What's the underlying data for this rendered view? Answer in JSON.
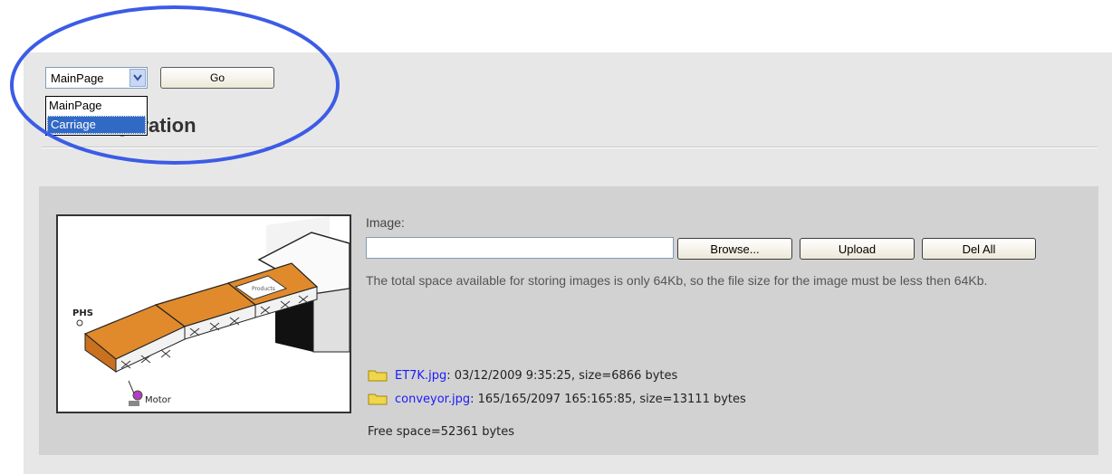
{
  "nav": {
    "select_value": "MainPage",
    "go_label": "Go",
    "options": [
      "MainPage",
      "Carriage"
    ],
    "highlighted_option": "Carriage"
  },
  "page": {
    "title": "e Configuration"
  },
  "preview": {
    "label_phs": "PHS",
    "label_motor": "Motor",
    "label_products": "Products"
  },
  "upload": {
    "image_label": "Image:",
    "file_value": "",
    "browse_label": "Browse...",
    "upload_label": "Upload",
    "delall_label": "Del All",
    "info_text": "The total space available for storing images is only 64Kb, so the file size for the image must be less then 64Kb."
  },
  "files": [
    {
      "name": "ET7K.jpg",
      "details": ": 03/12/2009 9:35:25, size=6866 bytes"
    },
    {
      "name": "conveyor.jpg",
      "details": ": 165/165/2097 165:165:85, size=13111 bytes"
    }
  ],
  "free_space": "Free space=52361 bytes",
  "colors": {
    "annotation_circle": "#3b5ce6",
    "conveyor": "#e08a2c",
    "link": "#1a1aff"
  }
}
